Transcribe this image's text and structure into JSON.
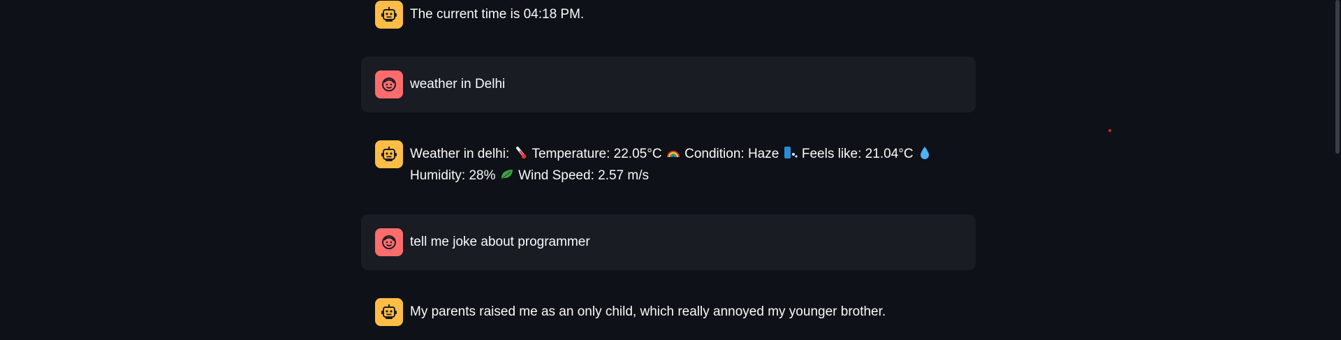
{
  "messages": [
    {
      "role": "assistant",
      "avatar_icon": "robot-face-icon",
      "text": "The current time is 04:18 PM."
    },
    {
      "role": "user",
      "avatar_icon": "smiling-face-icon",
      "text": "weather in Delhi"
    },
    {
      "role": "assistant",
      "avatar_icon": "robot-face-icon",
      "weather": {
        "prefix": "Weather in delhi:",
        "temperature": "Temperature: 22.05°C",
        "condition": "Condition: Haze",
        "feels_like": "Feels like: 21.04°C",
        "humidity": "Humidity: 28%",
        "wind": "Wind Speed: 2.57 m/s"
      }
    },
    {
      "role": "user",
      "avatar_icon": "smiling-face-icon",
      "text": "tell me joke about programmer"
    },
    {
      "role": "assistant",
      "avatar_icon": "robot-face-icon",
      "text": "My parents raised me as an only child, which really annoyed my younger brother."
    }
  ],
  "colors": {
    "background": "#0e1117",
    "user_message_bg": "#1a1c24",
    "assistant_avatar": "#ffbd45",
    "user_avatar": "#ff6c6c"
  }
}
